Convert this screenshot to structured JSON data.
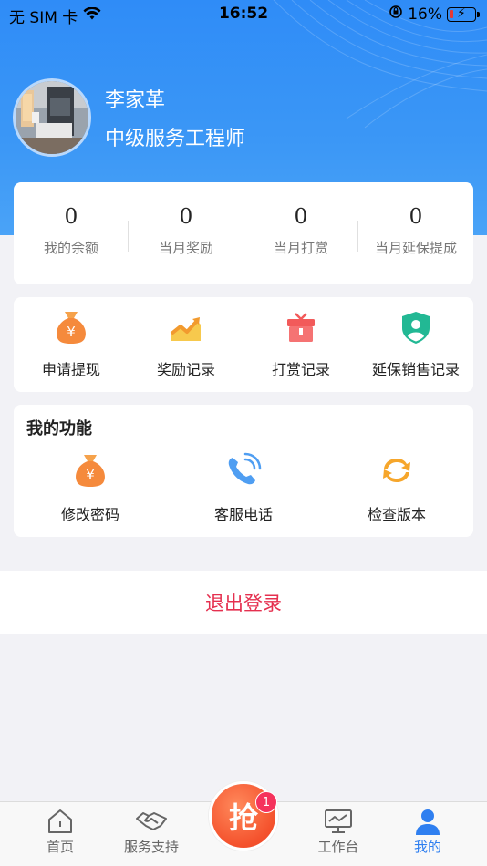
{
  "status": {
    "carrier": "无 SIM 卡",
    "time": "16:52",
    "battery_percent": "16%",
    "battery_level": 0.16
  },
  "profile": {
    "name": "李家革",
    "title": "中级服务工程师"
  },
  "stats": [
    {
      "value": "0",
      "label": "我的余额"
    },
    {
      "value": "0",
      "label": "当月奖励"
    },
    {
      "value": "0",
      "label": "当月打赏"
    },
    {
      "value": "0",
      "label": "当月延保提成"
    }
  ],
  "quick_actions": [
    {
      "label": "申请提现",
      "icon": "money-bag-icon"
    },
    {
      "label": "奖励记录",
      "icon": "rising-chart-icon"
    },
    {
      "label": "打赏记录",
      "icon": "gift-box-icon"
    },
    {
      "label": "延保销售记录",
      "icon": "shield-user-icon"
    }
  ],
  "functions": {
    "title": "我的功能",
    "items": [
      {
        "label": "修改密码",
        "icon": "money-bag-icon"
      },
      {
        "label": "客服电话",
        "icon": "phone-icon"
      },
      {
        "label": "检查版本",
        "icon": "refresh-icon"
      }
    ]
  },
  "logout_label": "退出登录",
  "tabbar": {
    "tabs": [
      {
        "label": "首页",
        "icon": "home-icon"
      },
      {
        "label": "服务支持",
        "icon": "handshake-icon"
      },
      {
        "label": "工作台",
        "icon": "monitor-icon"
      },
      {
        "label": "我的",
        "icon": "user-icon",
        "active": true
      }
    ],
    "grab_label": "抢",
    "grab_badge": "1"
  },
  "colors": {
    "header_blue": "#2f8cf7",
    "accent_blue": "#2f7ff0",
    "logout_red": "#e5304f",
    "grab_orange": "#f4512c",
    "badge_pink": "#f5325c"
  }
}
